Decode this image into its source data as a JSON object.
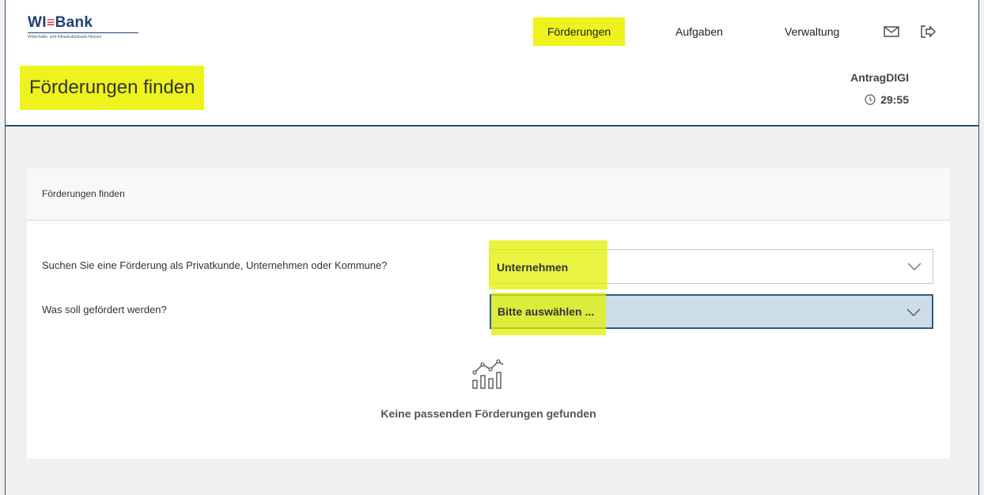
{
  "brand": {
    "name_part1": "WI",
    "name_bar": "≡",
    "name_part2": "Bank",
    "subtitle": "Wirtschafts- und Infrastrukturbank Hessen"
  },
  "nav": {
    "items": [
      {
        "label": "Förderungen",
        "active": true
      },
      {
        "label": "Aufgaben",
        "active": false
      },
      {
        "label": "Verwaltung",
        "active": false
      }
    ],
    "icons": [
      "mail-icon",
      "logout-icon"
    ]
  },
  "page": {
    "title": "Förderungen finden"
  },
  "app": {
    "name": "AntragDIGI",
    "timer": "29:55"
  },
  "card": {
    "title": "Förderungen finden",
    "questions": [
      {
        "label": "Suchen Sie eine Förderung als Privatkunde, Unternehmen oder Kommune?",
        "value": "Unternehmen"
      },
      {
        "label": "Was soll gefördert werden?",
        "value": "Bitte auswählen ..."
      }
    ],
    "empty_text": "Keine passenden Förderungen gefunden"
  },
  "colors": {
    "highlight": "#eef21d",
    "brand": "#1b3f79",
    "focus_bg": "#ccdde8",
    "border": "#2b4f7e"
  }
}
